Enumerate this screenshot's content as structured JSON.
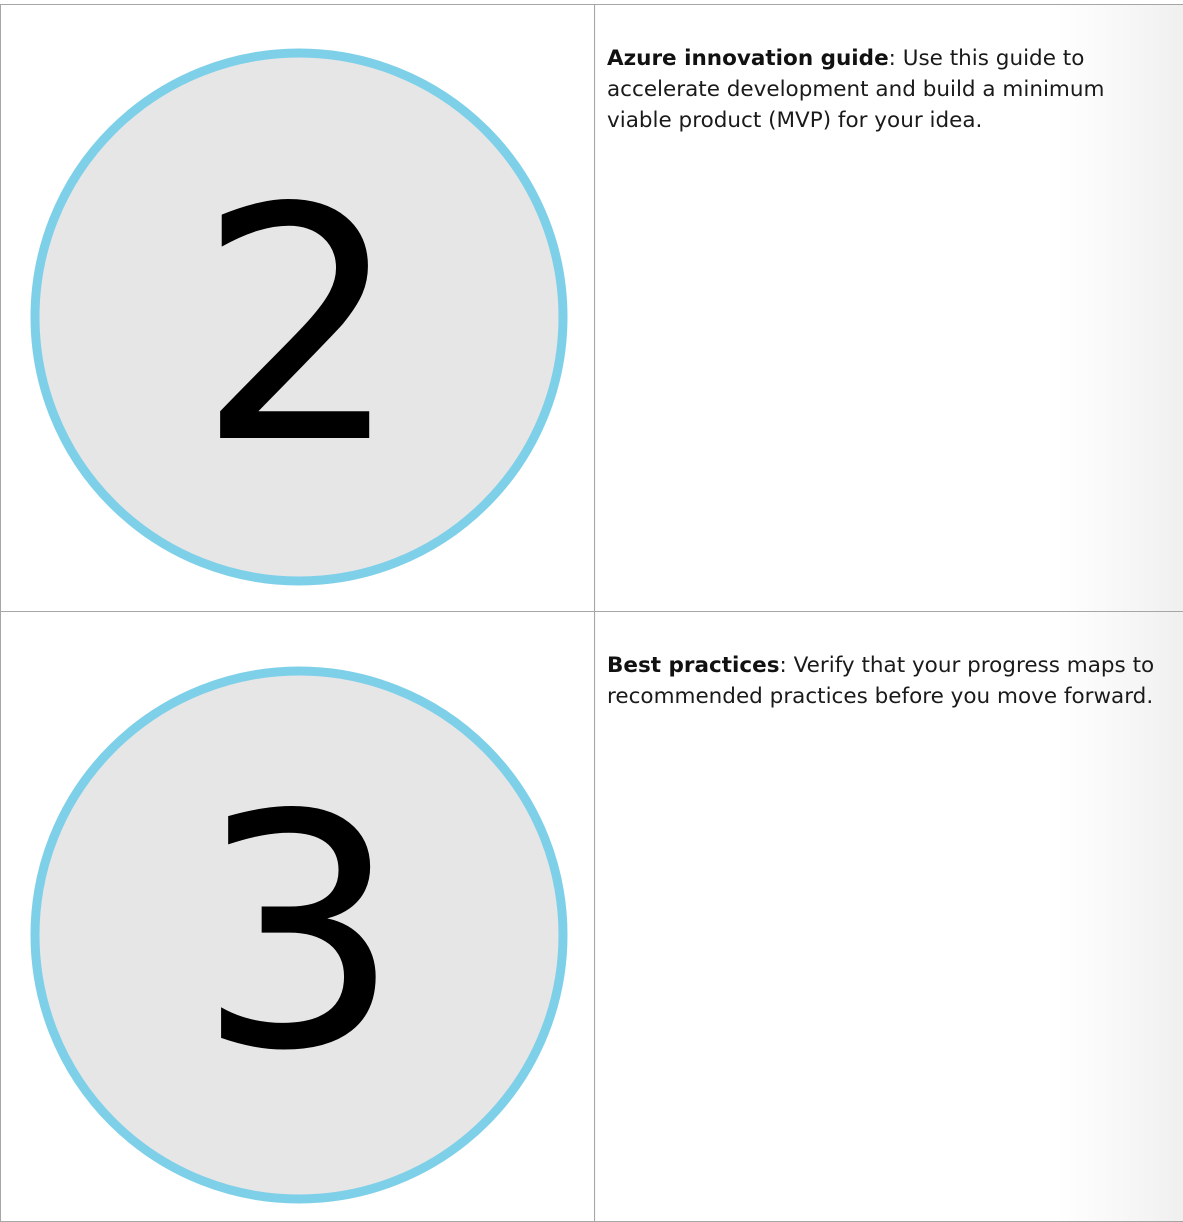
{
  "steps": [
    {
      "number": "2",
      "icon": "numbered-circle-icon",
      "title": "Azure innovation guide",
      "separator": ":",
      "description": " Use this guide to accelerate development and build a minimum viable product (MVP) for your idea."
    },
    {
      "number": "3",
      "icon": "numbered-circle-icon",
      "title": "Best practices",
      "separator": ":",
      "description": " Verify that your progress maps to recommended practices before you move forward."
    }
  ],
  "colors": {
    "circle_fill": "#e6e6e6",
    "circle_ring": "#7ed0e9",
    "digit": "#000000",
    "border": "#a6a6a6"
  }
}
